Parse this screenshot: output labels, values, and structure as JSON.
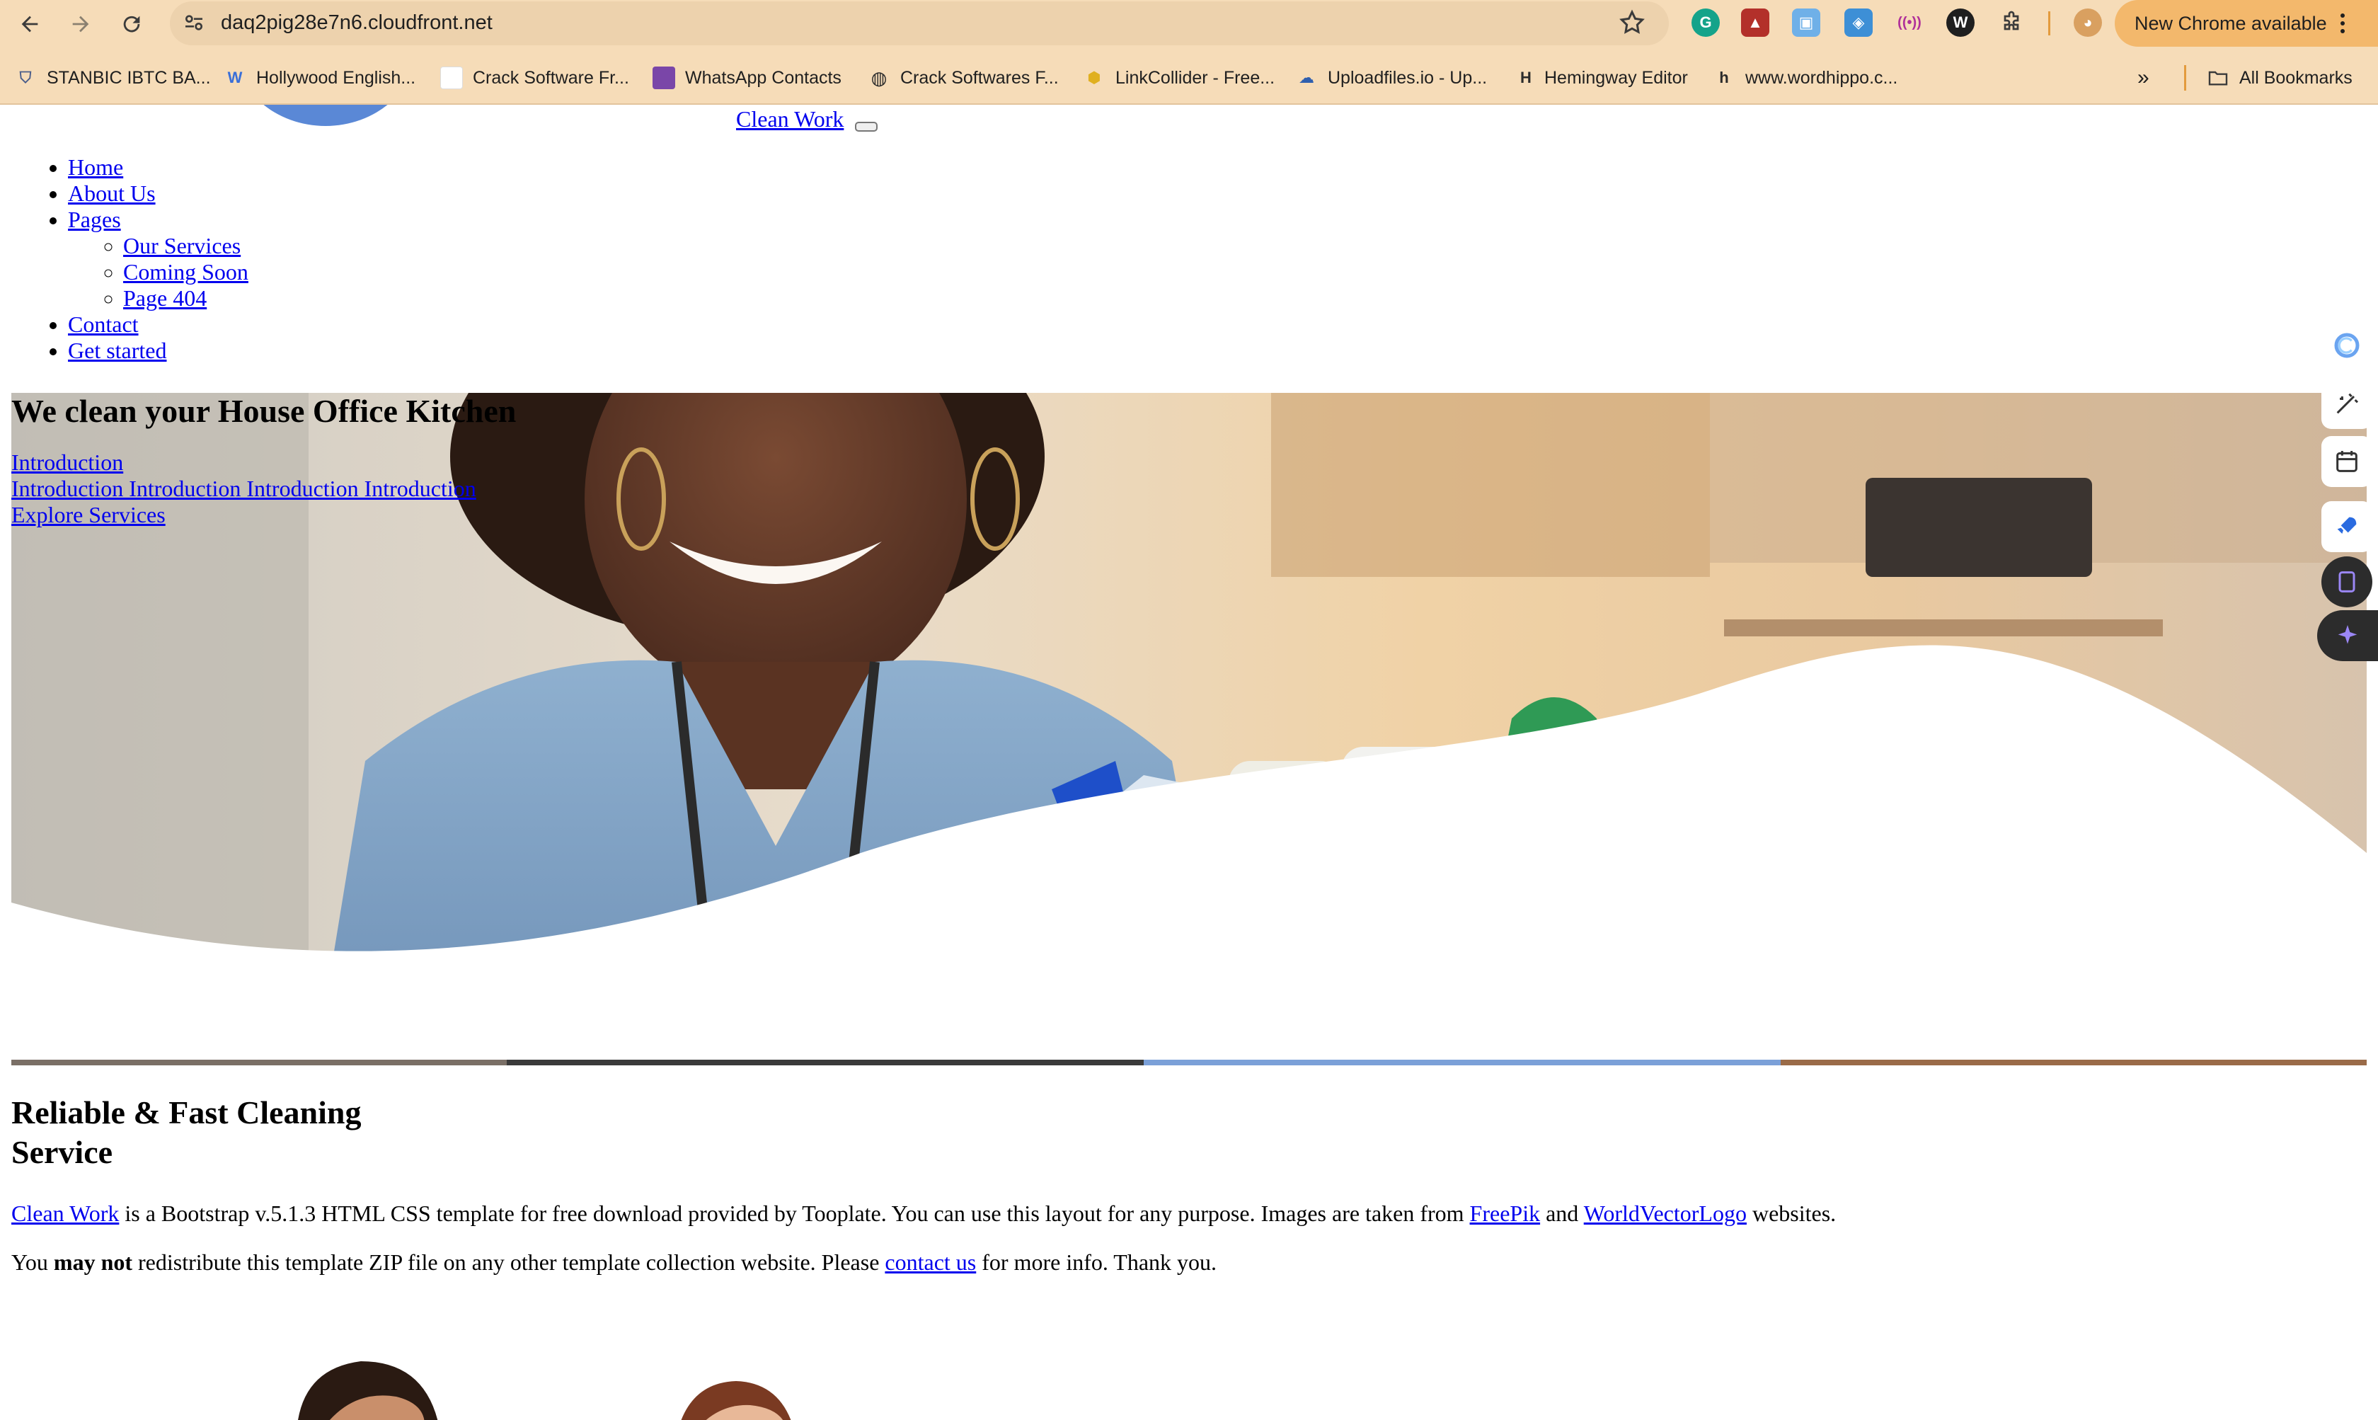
{
  "browser": {
    "url": "daq2pig28e7n6.cloudfront.net",
    "update_button": "New Chrome available",
    "bookmarks": [
      {
        "label": "STANBIC IBTC BA...",
        "icon": "shield-icon"
      },
      {
        "label": "Hollywood English...",
        "icon": "w-logo-icon"
      },
      {
        "label": "Crack Software Fr...",
        "icon": "blank-page-icon"
      },
      {
        "label": "WhatsApp Contacts",
        "icon": "purple-square-icon"
      },
      {
        "label": "Crack Softwares F...",
        "icon": "globe-icon"
      },
      {
        "label": "LinkCollider - Free...",
        "icon": "python-logo-icon"
      },
      {
        "label": "Uploadfiles.io - Up...",
        "icon": "cloud-icon"
      },
      {
        "label": "Hemingway Editor",
        "icon": "h-logo-icon"
      },
      {
        "label": "www.wordhippo.c...",
        "icon": "h-lowercase-icon"
      }
    ],
    "all_bookmarks": "All Bookmarks",
    "extensions": [
      "grammarly-icon",
      "pdf-icon",
      "screenshot-icon",
      "image-icon",
      "radio-icon",
      "wordtune-icon",
      "puzzle-icon",
      "profile-avatar-icon"
    ]
  },
  "site": {
    "brand": "Clean Work",
    "nav": {
      "home": "Home",
      "about": "About Us",
      "pages": "Pages",
      "pages_sub": [
        "Our Services",
        "Coming Soon",
        "Page 404"
      ],
      "contact": "Contact",
      "get_started": "Get started"
    },
    "hero": {
      "title": "We clean your House Office Kitchen",
      "link1": "Introduction",
      "link2": "Introduction Introduction Introduction Introduction",
      "link3": "Explore Services"
    },
    "about": {
      "title": "Reliable & Fast Cleaning Service",
      "p1_link": "Clean Work",
      "p1_text_a": " is a Bootstrap v.5.1.3 HTML CSS template for free download provided by Tooplate. You can use this layout for any purpose. Images are taken from ",
      "p1_link2": "FreePik",
      "p1_text_b": " and ",
      "p1_link3": "WorldVectorLogo",
      "p1_text_c": " websites.",
      "p2_text_a": "You ",
      "p2_bold": "may not",
      "p2_text_b": " redistribute this template ZIP file on any other template collection website. Please ",
      "p2_link": "contact us",
      "p2_text_c": " for more info. Thank you."
    }
  },
  "colors": {
    "chrome_bg": "#f6dcb8",
    "omnibox_bg": "#edd2ad",
    "update_btn": "#f3b86c",
    "link": "#0000ee",
    "logo_blue": "#5a88d6"
  }
}
